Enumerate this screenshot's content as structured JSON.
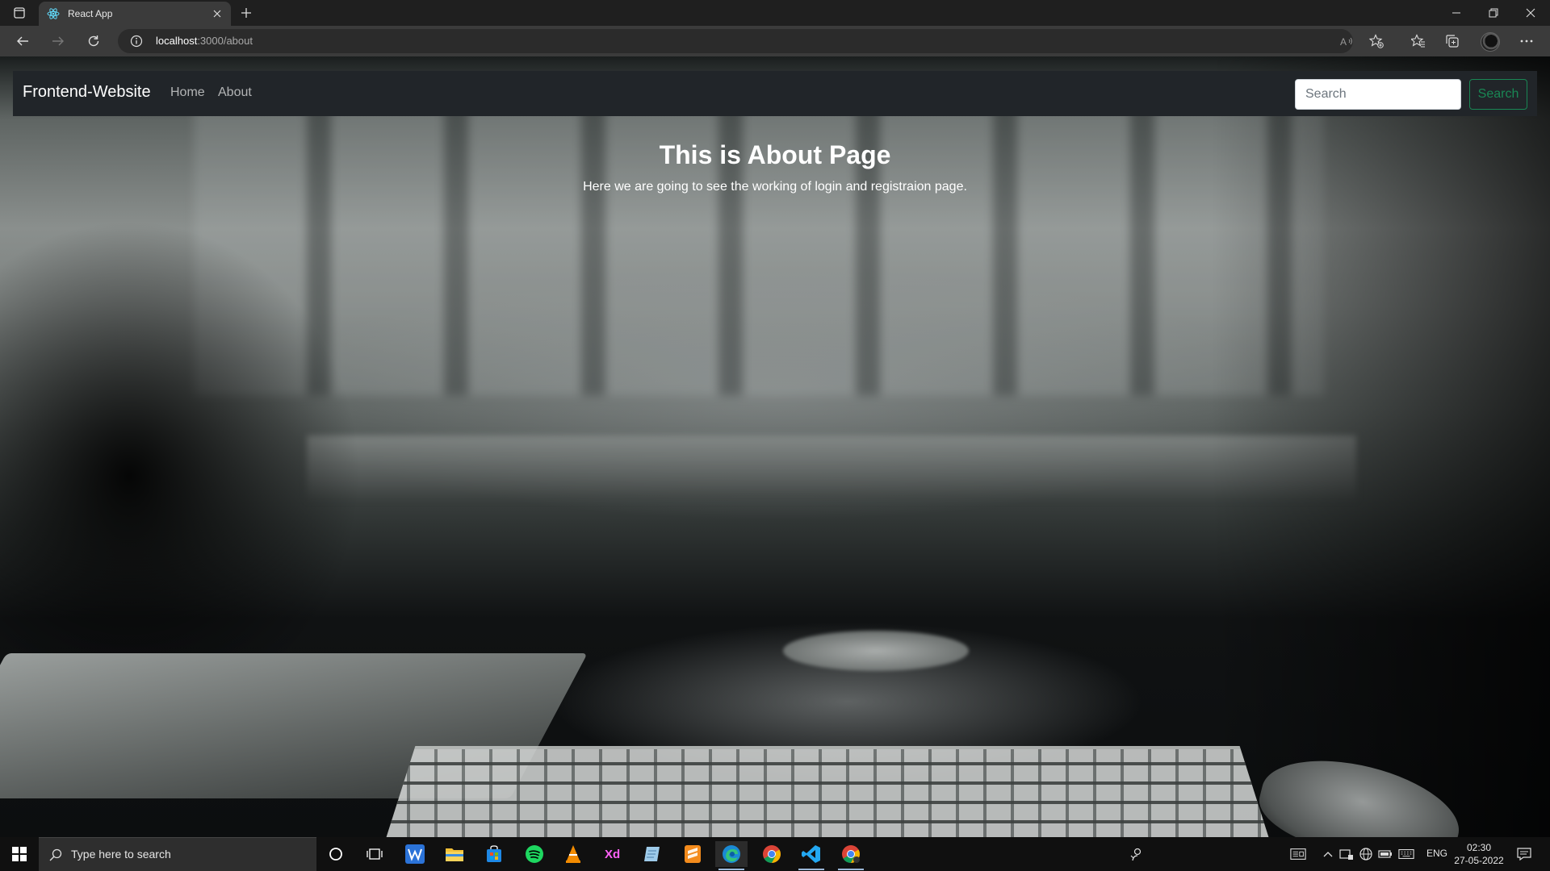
{
  "browser": {
    "tab": {
      "title": "React App",
      "favicon": "react-logo-icon"
    },
    "url": {
      "host": "localhost",
      "path": ":3000/about"
    },
    "icons": [
      "tab-actions-icon",
      "close-icon",
      "plus-icon",
      "minimize-icon",
      "restore-icon",
      "close-window-icon",
      "back-icon",
      "forward-icon",
      "refresh-icon",
      "info-icon",
      "read-aloud-icon",
      "add-favorite-icon",
      "favorites-icon",
      "collections-icon",
      "profile-avatar",
      "more-icon"
    ]
  },
  "navbar": {
    "brand": "Frontend-Website",
    "links": [
      {
        "label": "Home"
      },
      {
        "label": "About"
      }
    ],
    "search": {
      "placeholder": "Search",
      "button_label": "Search"
    },
    "colors": {
      "background": "#212529",
      "accent": "#198754"
    }
  },
  "page": {
    "title": "This is About Page",
    "text": "Here we are going to see the working of login and registraion page."
  },
  "taskbar": {
    "search_placeholder": "Type here to search",
    "apps": [
      "cortana-icon",
      "task-view-icon",
      "app-w-icon",
      "file-explorer-icon",
      "store-icon",
      "spotify-icon",
      "vlc-icon",
      "adobe-xd-icon",
      "notepad-icon",
      "sublime-text-icon",
      "edge-icon",
      "chrome-icon",
      "vscode-icon",
      "chrome-dev-icon"
    ],
    "adobe_xd_label": "Xd",
    "tray": {
      "language": "ENG",
      "time": "02:30",
      "date": "27-05-2022"
    }
  }
}
